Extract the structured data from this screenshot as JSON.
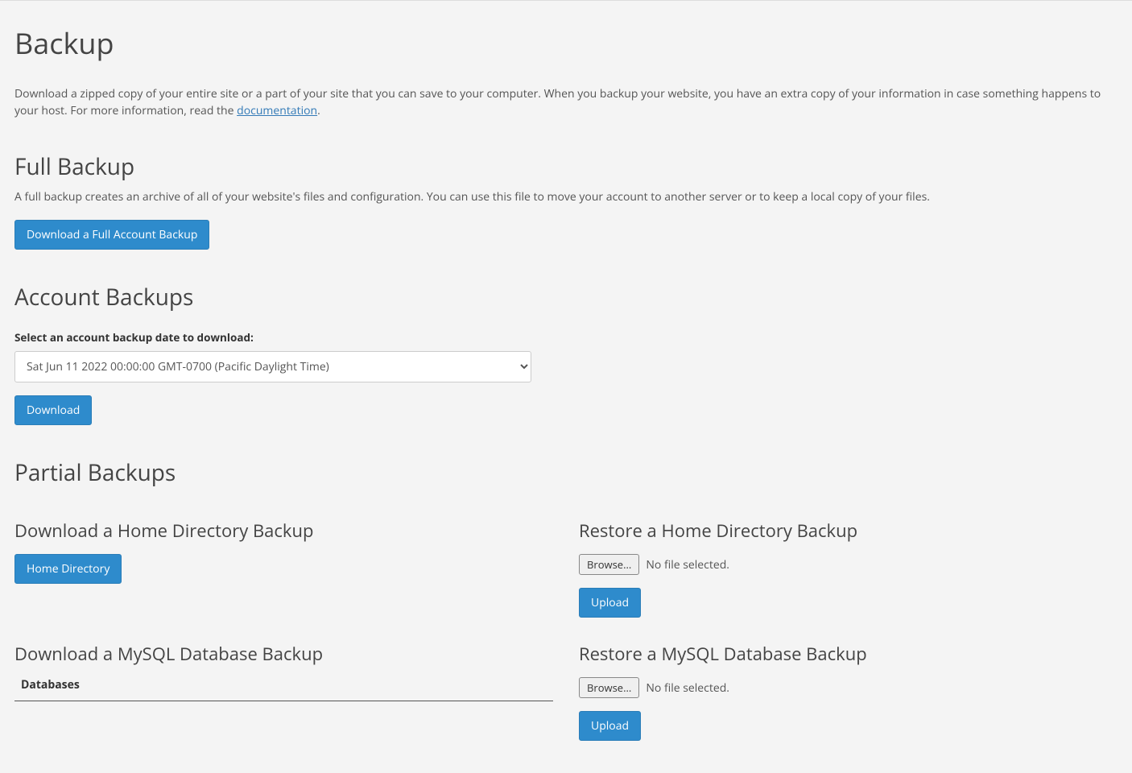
{
  "page": {
    "title": "Backup",
    "intro_prefix": "Download a zipped copy of your entire site or a part of your site that you can save to your computer. When you backup your website, you have an extra copy of your information in case something happens to your host. For more information, read the ",
    "intro_link": "documentation",
    "intro_suffix": "."
  },
  "full_backup": {
    "heading": "Full Backup",
    "desc": "A full backup creates an archive of all of your website's files and configuration. You can use this file to move your account to another server or to keep a local copy of your files.",
    "button": "Download a Full Account Backup"
  },
  "account_backups": {
    "heading": "Account Backups",
    "label": "Select an account backup date to download:",
    "selected": "Sat Jun 11 2022 00:00:00 GMT-0700 (Pacific Daylight Time)",
    "download_button": "Download"
  },
  "partial": {
    "heading": "Partial Backups",
    "download_home": {
      "heading": "Download a Home Directory Backup",
      "button": "Home Directory"
    },
    "restore_home": {
      "heading": "Restore a Home Directory Backup",
      "browse": "Browse...",
      "nofile": "No file selected.",
      "upload": "Upload"
    },
    "download_db": {
      "heading": "Download a MySQL Database Backup",
      "table_header": "Databases"
    },
    "restore_db": {
      "heading": "Restore a MySQL Database Backup",
      "browse": "Browse...",
      "nofile": "No file selected.",
      "upload": "Upload"
    }
  }
}
